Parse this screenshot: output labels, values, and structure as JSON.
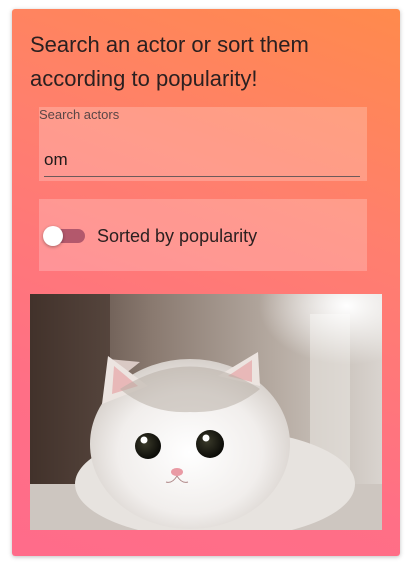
{
  "heading": "Search an actor or sort them according to popularity!",
  "search": {
    "label": "Search actors",
    "value": "om"
  },
  "sort_toggle": {
    "label": "Sorted by popularity",
    "checked": false
  },
  "image": {
    "subject": "white-and-grey kitten"
  },
  "colors": {
    "gradient_top": "#ff8a4c",
    "gradient_bottom": "#ff6c8a",
    "switch_track": "#b3586c"
  }
}
